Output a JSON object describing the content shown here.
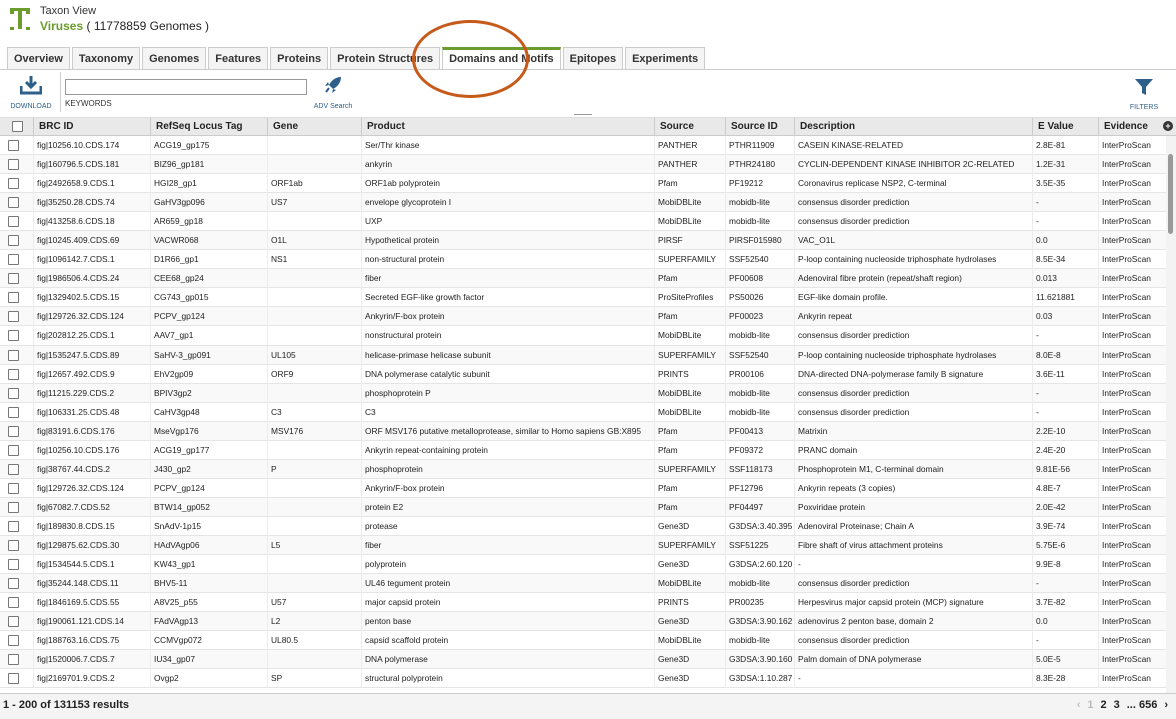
{
  "header": {
    "view_label": "Taxon View",
    "taxon_name": "Viruses",
    "genome_count": "( 11778859 Genomes )",
    "accent_color": "#6a9c2e"
  },
  "tabs": [
    {
      "label": "Overview"
    },
    {
      "label": "Taxonomy"
    },
    {
      "label": "Genomes"
    },
    {
      "label": "Features"
    },
    {
      "label": "Proteins"
    },
    {
      "label": "Protein Structures"
    },
    {
      "label": "Domains and Motifs",
      "active": true
    },
    {
      "label": "Epitopes"
    },
    {
      "label": "Experiments"
    }
  ],
  "toolbar": {
    "download_label": "DOWNLOAD",
    "keyword_value": "",
    "keyword_label": "KEYWORDS",
    "adv_search_label": "ADV Search",
    "filters_label": "FILTERS"
  },
  "columns": [
    "BRC ID",
    "RefSeq Locus Tag",
    "Gene",
    "Product",
    "Source",
    "Source ID",
    "Description",
    "E Value",
    "Evidence"
  ],
  "rows": [
    [
      "fig|10256.10.CDS.174",
      "ACG19_gp175",
      "",
      "Ser/Thr kinase",
      "PANTHER",
      "PTHR11909",
      "CASEIN KINASE-RELATED",
      "2.8E-81",
      "InterProScan"
    ],
    [
      "fig|160796.5.CDS.181",
      "BIZ96_gp181",
      "",
      "ankyrin",
      "PANTHER",
      "PTHR24180",
      "CYCLIN-DEPENDENT KINASE INHIBITOR 2C-RELATED",
      "1.2E-31",
      "InterProScan"
    ],
    [
      "fig|2492658.9.CDS.1",
      "HGI28_gp1",
      "ORF1ab",
      "ORF1ab polyprotein",
      "Pfam",
      "PF19212",
      "Coronavirus replicase NSP2, C-terminal",
      "3.5E-35",
      "InterProScan"
    ],
    [
      "fig|35250.28.CDS.74",
      "GaHV3gp096",
      "US7",
      "envelope glycoprotein I",
      "MobiDBLite",
      "mobidb-lite",
      "consensus disorder prediction",
      "-",
      "InterProScan"
    ],
    [
      "fig|413258.6.CDS.18",
      "AR659_gp18",
      "",
      "UXP",
      "MobiDBLite",
      "mobidb-lite",
      "consensus disorder prediction",
      "-",
      "InterProScan"
    ],
    [
      "fig|10245.409.CDS.69",
      "VACWR068",
      "O1L",
      "Hypothetical protein",
      "PIRSF",
      "PIRSF015980",
      "VAC_O1L",
      "0.0",
      "InterProScan"
    ],
    [
      "fig|1096142.7.CDS.1",
      "D1R66_gp1",
      "NS1",
      "non-structural protein",
      "SUPERFAMILY",
      "SSF52540",
      "P-loop containing nucleoside triphosphate hydrolases",
      "8.5E-34",
      "InterProScan"
    ],
    [
      "fig|1986506.4.CDS.24",
      "CEE68_gp24",
      "",
      "fiber",
      "Pfam",
      "PF00608",
      "Adenoviral fibre protein (repeat/shaft region)",
      "0.013",
      "InterProScan"
    ],
    [
      "fig|1329402.5.CDS.15",
      "CG743_gp015",
      "",
      "Secreted EGF-like growth factor",
      "ProSiteProfiles",
      "PS50026",
      "EGF-like domain profile.",
      "11.621881",
      "InterProScan"
    ],
    [
      "fig|129726.32.CDS.124",
      "PCPV_gp124",
      "",
      "Ankyrin/F-box protein",
      "Pfam",
      "PF00023",
      "Ankyrin repeat",
      "0.03",
      "InterProScan"
    ],
    [
      "fig|202812.25.CDS.1",
      "AAV7_gp1",
      "",
      "nonstructural protein",
      "MobiDBLite",
      "mobidb-lite",
      "consensus disorder prediction",
      "-",
      "InterProScan"
    ],
    [
      "fig|1535247.5.CDS.89",
      "SaHV-3_gp091",
      "UL105",
      "helicase-primase helicase subunit",
      "SUPERFAMILY",
      "SSF52540",
      "P-loop containing nucleoside triphosphate hydrolases",
      "8.0E-8",
      "InterProScan"
    ],
    [
      "fig|12657.492.CDS.9",
      "EhV2gp09",
      "ORF9",
      "DNA polymerase catalytic subunit",
      "PRINTS",
      "PR00106",
      "DNA-directed DNA-polymerase family B signature",
      "3.6E-11",
      "InterProScan"
    ],
    [
      "fig|11215.229.CDS.2",
      "BPIV3gp2",
      "",
      "phosphoprotein P",
      "MobiDBLite",
      "mobidb-lite",
      "consensus disorder prediction",
      "-",
      "InterProScan"
    ],
    [
      "fig|106331.25.CDS.48",
      "CaHV3gp48",
      "C3",
      "C3",
      "MobiDBLite",
      "mobidb-lite",
      "consensus disorder prediction",
      "-",
      "InterProScan"
    ],
    [
      "fig|83191.6.CDS.176",
      "MseVgp176",
      "MSV176",
      "ORF MSV176 putative metalloprotease, similar to Homo sapiens GB:X895",
      "Pfam",
      "PF00413",
      "Matrixin",
      "2.2E-10",
      "InterProScan"
    ],
    [
      "fig|10256.10.CDS.176",
      "ACG19_gp177",
      "",
      "Ankyrin repeat-containing protein",
      "Pfam",
      "PF09372",
      "PRANC domain",
      "2.4E-20",
      "InterProScan"
    ],
    [
      "fig|38767.44.CDS.2",
      "J430_gp2",
      "P",
      "phosphoprotein",
      "SUPERFAMILY",
      "SSF118173",
      "Phosphoprotein M1, C-terminal domain",
      "9.81E-56",
      "InterProScan"
    ],
    [
      "fig|129726.32.CDS.124",
      "PCPV_gp124",
      "",
      "Ankyrin/F-box protein",
      "Pfam",
      "PF12796",
      "Ankyrin repeats (3 copies)",
      "4.8E-7",
      "InterProScan"
    ],
    [
      "fig|67082.7.CDS.52",
      "BTW14_gp052",
      "",
      "protein E2",
      "Pfam",
      "PF04497",
      "Poxviridae protein",
      "2.0E-42",
      "InterProScan"
    ],
    [
      "fig|189830.8.CDS.15",
      "SnAdV-1p15",
      "",
      "protease",
      "Gene3D",
      "G3DSA:3.40.395",
      "Adenoviral Proteinase; Chain A",
      "3.9E-74",
      "InterProScan"
    ],
    [
      "fig|129875.62.CDS.30",
      "HAdVAgp06",
      "L5",
      "fiber",
      "SUPERFAMILY",
      "SSF51225",
      "Fibre shaft of virus attachment proteins",
      "5.75E-6",
      "InterProScan"
    ],
    [
      "fig|1534544.5.CDS.1",
      "KW43_gp1",
      "",
      "polyprotein",
      "Gene3D",
      "G3DSA:2.60.120",
      "-",
      "9.9E-8",
      "InterProScan"
    ],
    [
      "fig|35244.148.CDS.11",
      "BHV5-11",
      "",
      "UL46 tegument protein",
      "MobiDBLite",
      "mobidb-lite",
      "consensus disorder prediction",
      "-",
      "InterProScan"
    ],
    [
      "fig|1846169.5.CDS.55",
      "A8V25_p55",
      "U57",
      "major capsid protein",
      "PRINTS",
      "PR00235",
      "Herpesvirus major capsid protein (MCP) signature",
      "3.7E-82",
      "InterProScan"
    ],
    [
      "fig|190061.121.CDS.14",
      "FAdVAgp13",
      "L2",
      "penton base",
      "Gene3D",
      "G3DSA:3.90.162",
      "adenovirus 2 penton base, domain 2",
      "0.0",
      "InterProScan"
    ],
    [
      "fig|188763.16.CDS.75",
      "CCMVgp072",
      "UL80.5",
      "capsid scaffold protein",
      "MobiDBLite",
      "mobidb-lite",
      "consensus disorder prediction",
      "-",
      "InterProScan"
    ],
    [
      "fig|1520006.7.CDS.7",
      "IU34_gp07",
      "",
      "DNA polymerase",
      "Gene3D",
      "G3DSA:3.90.160",
      "Palm domain of DNA polymerase",
      "5.0E-5",
      "InterProScan"
    ],
    [
      "fig|2169701.9.CDS.2",
      "Ovgp2",
      "SP",
      "structural polyprotein",
      "Gene3D",
      "G3DSA:1.10.287",
      "-",
      "8.3E-28",
      "InterProScan"
    ]
  ],
  "footer": {
    "result_count": "1 - 200 of 131153 results",
    "pages": [
      "2",
      "3",
      "... 656",
      "›"
    ],
    "prev": "‹",
    "current": "1"
  }
}
